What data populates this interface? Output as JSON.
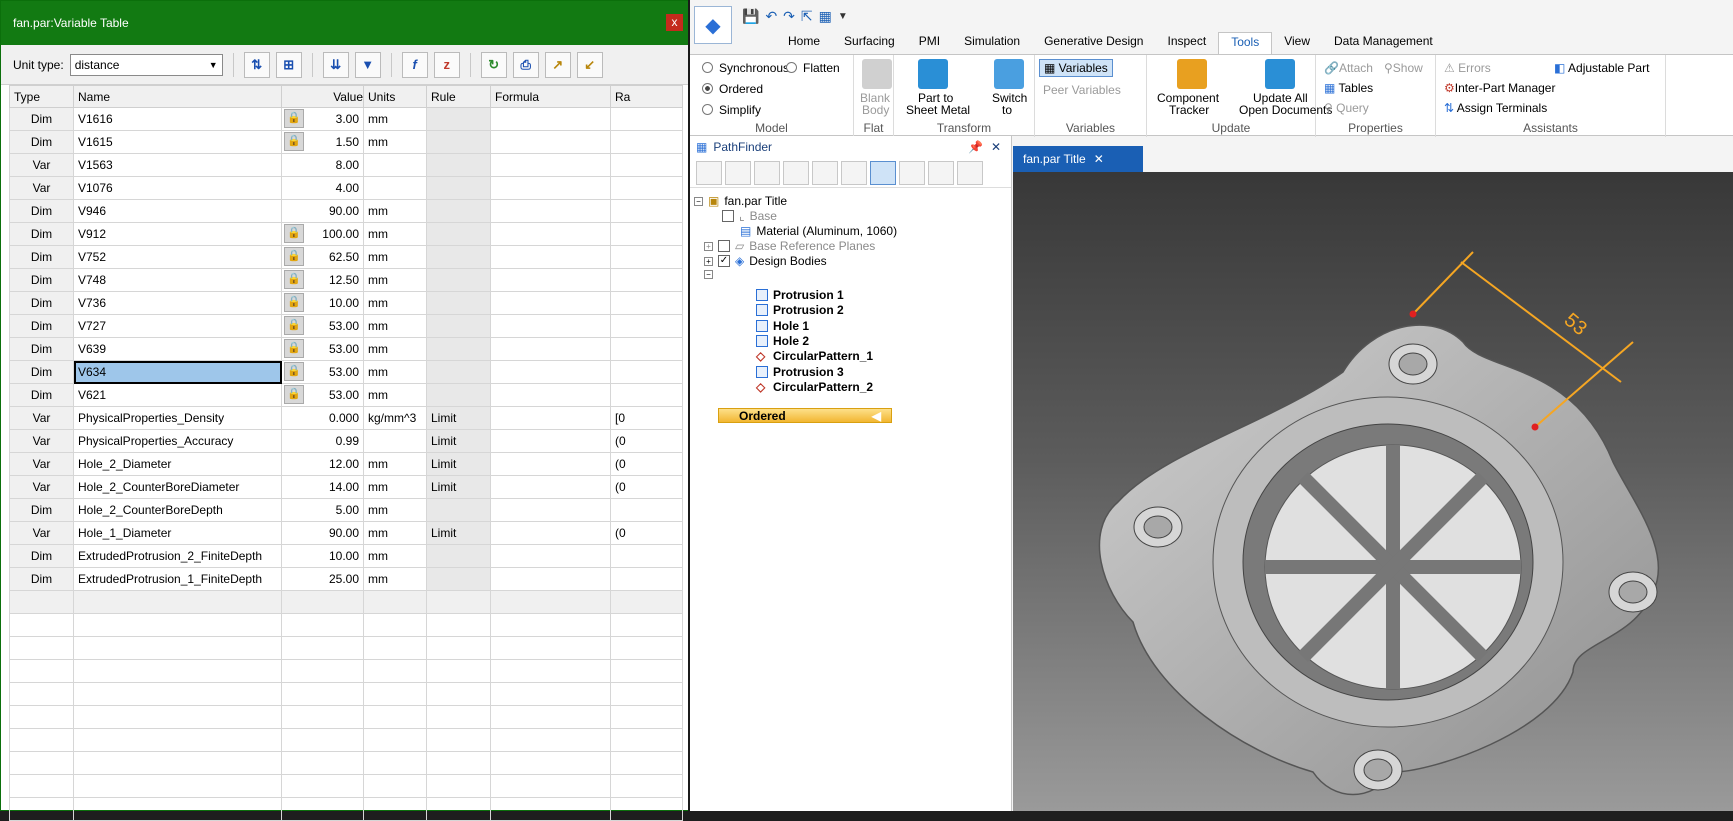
{
  "vt": {
    "title": "fan.par:Variable Table",
    "close": "x",
    "unit_label": "Unit type:",
    "unit_value": "distance"
  },
  "cols": [
    "Type",
    "Name",
    "Value",
    "Units",
    "Rule",
    "Formula",
    "Ra"
  ],
  "rows": [
    {
      "type": "Dim",
      "name": "V1616",
      "lock": true,
      "value": "3.00",
      "units": "mm",
      "rule": "",
      "range": ""
    },
    {
      "type": "Dim",
      "name": "V1615",
      "lock": true,
      "value": "1.50",
      "units": "mm",
      "rule": "",
      "range": ""
    },
    {
      "type": "Var",
      "name": "V1563",
      "lock": false,
      "value": "8.00",
      "units": "",
      "rule": "",
      "range": ""
    },
    {
      "type": "Var",
      "name": "V1076",
      "lock": false,
      "value": "4.00",
      "units": "",
      "rule": "",
      "range": ""
    },
    {
      "type": "Dim",
      "name": "V946",
      "lock": false,
      "value": "90.00",
      "units": "mm",
      "rule": "",
      "range": ""
    },
    {
      "type": "Dim",
      "name": "V912",
      "lock": true,
      "value": "100.00",
      "units": "mm",
      "rule": "",
      "range": ""
    },
    {
      "type": "Dim",
      "name": "V752",
      "lock": true,
      "value": "62.50",
      "units": "mm",
      "rule": "",
      "range": ""
    },
    {
      "type": "Dim",
      "name": "V748",
      "lock": true,
      "value": "12.50",
      "units": "mm",
      "rule": "",
      "range": ""
    },
    {
      "type": "Dim",
      "name": "V736",
      "lock": true,
      "value": "10.00",
      "units": "mm",
      "rule": "",
      "range": ""
    },
    {
      "type": "Dim",
      "name": "V727",
      "lock": true,
      "value": "53.00",
      "units": "mm",
      "rule": "",
      "range": ""
    },
    {
      "type": "Dim",
      "name": "V639",
      "lock": true,
      "value": "53.00",
      "units": "mm",
      "rule": "",
      "range": ""
    },
    {
      "type": "Dim",
      "name": "V634",
      "lock": true,
      "value": "53.00",
      "units": "mm",
      "rule": "",
      "range": "",
      "selected": true
    },
    {
      "type": "Dim",
      "name": "V621",
      "lock": true,
      "value": "53.00",
      "units": "mm",
      "rule": "",
      "range": ""
    },
    {
      "type": "Var",
      "name": "PhysicalProperties_Density",
      "lock": false,
      "value": "0.000",
      "units": "kg/mm^3",
      "rule": "Limit",
      "range": "[0"
    },
    {
      "type": "Var",
      "name": "PhysicalProperties_Accuracy",
      "lock": false,
      "value": "0.99",
      "units": "",
      "rule": "Limit",
      "range": "(0"
    },
    {
      "type": "Var",
      "name": "Hole_2_Diameter",
      "lock": false,
      "value": "12.00",
      "units": "mm",
      "rule": "Limit",
      "range": "(0"
    },
    {
      "type": "Var",
      "name": "Hole_2_CounterBoreDiameter",
      "lock": false,
      "value": "14.00",
      "units": "mm",
      "rule": "Limit",
      "range": "(0"
    },
    {
      "type": "Dim",
      "name": "Hole_2_CounterBoreDepth",
      "lock": false,
      "value": "5.00",
      "units": "mm",
      "rule": "",
      "range": ""
    },
    {
      "type": "Var",
      "name": "Hole_1_Diameter",
      "lock": false,
      "value": "90.00",
      "units": "mm",
      "rule": "Limit",
      "range": "(0"
    },
    {
      "type": "Dim",
      "name": "ExtrudedProtrusion_2_FiniteDepth",
      "lock": false,
      "value": "10.00",
      "units": "mm",
      "rule": "",
      "range": ""
    },
    {
      "type": "Dim",
      "name": "ExtrudedProtrusion_1_FiniteDepth",
      "lock": false,
      "value": "25.00",
      "units": "mm",
      "rule": "",
      "range": ""
    }
  ],
  "tabs": [
    "Home",
    "Surfacing",
    "PMI",
    "Simulation",
    "Generative Design",
    "Inspect",
    "Tools",
    "View",
    "Data Management"
  ],
  "active_tab": "Tools",
  "ribbon": {
    "model": {
      "synchronous": "Synchronous",
      "flatten": "Flatten",
      "ordered": "Ordered",
      "simplify": "Simplify",
      "label": "Model"
    },
    "flat": {
      "blank": "Blank",
      "body": "Body",
      "label": "Flat"
    },
    "transform": {
      "part_to": "Part to",
      "sheet_metal": "Sheet Metal",
      "switch": "Switch",
      "to": "to",
      "label": "Transform"
    },
    "variables": {
      "variables": "Variables",
      "peer": "Peer Variables",
      "label": "Variables"
    },
    "update": {
      "component": "Component",
      "tracker": "Tracker",
      "update_all": "Update All",
      "open_docs": "Open Documents",
      "label": "Update"
    },
    "properties": {
      "attach": "Attach",
      "show": "Show",
      "tables": "Tables",
      "query": "Query",
      "label": "Properties"
    },
    "assistants": {
      "errors": "Errors",
      "adjustable": "Adjustable Part",
      "ipm": "Inter-Part Manager",
      "assign": "Assign Terminals",
      "label": "Assistants"
    }
  },
  "pathfinder": {
    "title": "PathFinder",
    "root": "fan.par Title",
    "base": "Base",
    "material": "Material (Aluminum, 1060)",
    "ref_planes": "Base Reference Planes",
    "design_bodies": "Design Bodies",
    "ordered": "Ordered",
    "features": [
      {
        "name": "Protrusion 1",
        "icon": "protrusion"
      },
      {
        "name": "Protrusion 2",
        "icon": "protrusion"
      },
      {
        "name": "Hole 1",
        "icon": "hole"
      },
      {
        "name": "Hole 2",
        "icon": "hole"
      },
      {
        "name": "CircularPattern_1",
        "icon": "pattern"
      },
      {
        "name": "Protrusion 3",
        "icon": "protrusion"
      },
      {
        "name": "CircularPattern_2",
        "icon": "pattern"
      }
    ]
  },
  "doc_tab": {
    "title": "fan.par Title",
    "close": "✕"
  },
  "viewport": {
    "dimension_value": "53",
    "dim_color": "#f5a623"
  }
}
